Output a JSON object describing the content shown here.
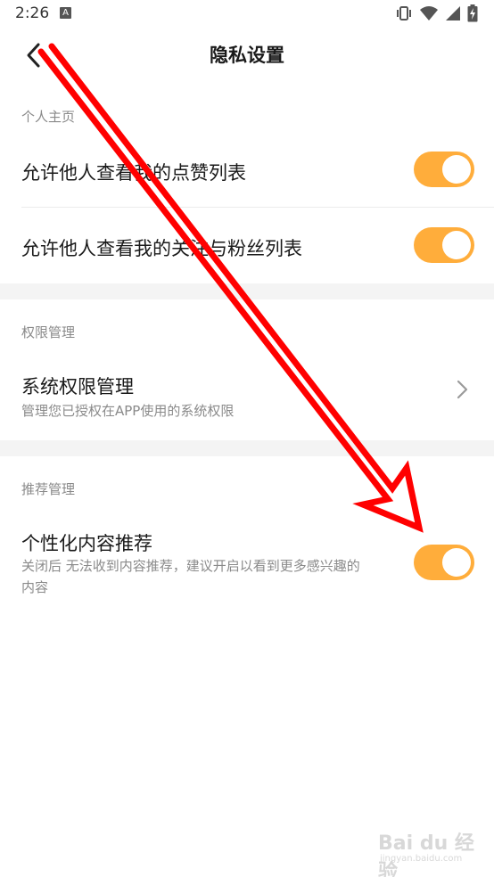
{
  "status_bar": {
    "time": "2:26",
    "notification_glyph": "A",
    "icons": [
      "vibrate-icon",
      "wifi-icon",
      "signal-icon",
      "battery-charging-icon"
    ]
  },
  "nav": {
    "title": "隐私设置",
    "back_icon": "chevron-left-icon"
  },
  "sections": {
    "homepage": {
      "header": "个人主页",
      "items": [
        {
          "label": "允许他人查看我的点赞列表",
          "toggle_on": true
        },
        {
          "label": "允许他人查看我的关注与粉丝列表",
          "toggle_on": true
        }
      ]
    },
    "permissions": {
      "header": "权限管理",
      "item": {
        "label": "系统权限管理",
        "subtitle": "管理您已授权在APP使用的系统权限"
      }
    },
    "recommend": {
      "header": "推荐管理",
      "item": {
        "label": "个性化内容推荐",
        "subtitle": "关闭后 无法收到内容推荐，建议开启以看到更多感兴趣的内容",
        "toggle_on": true
      }
    }
  },
  "colors": {
    "toggle_on": "#ffad3b",
    "annotation_arrow": "#ff0000",
    "secondary_text": "#8a8a8a"
  },
  "watermark": {
    "text": "Bai du 经验",
    "sub": "jingyan.baidu.com"
  }
}
